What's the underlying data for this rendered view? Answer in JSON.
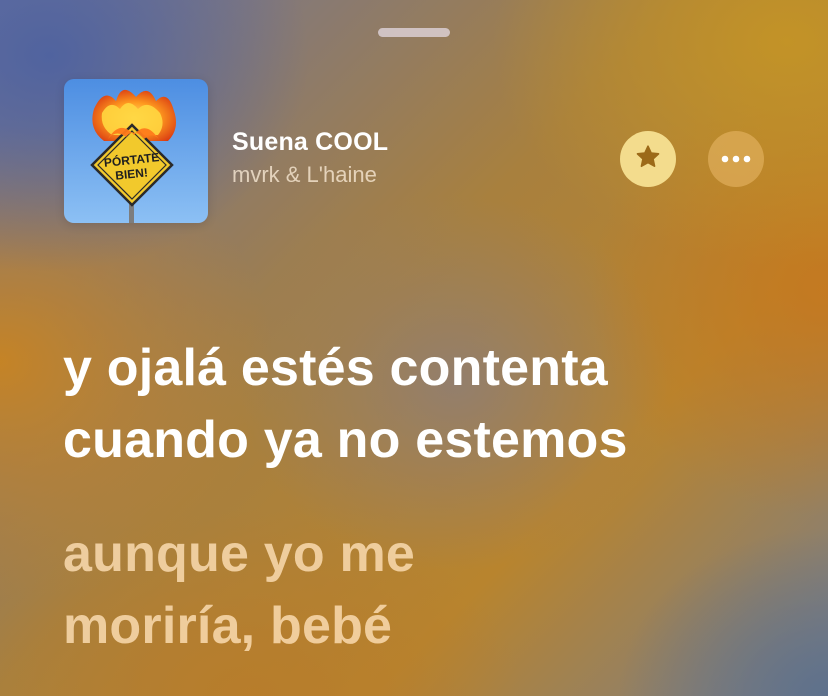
{
  "player": {
    "track_title": "Suena COOL",
    "artist": "mvrk & L'haine",
    "artwork": {
      "sign_line_1": "PÓRTATE",
      "sign_line_2": "BIEN!"
    },
    "favorite_icon": "star-icon",
    "more_icon": "ellipsis-icon"
  },
  "lyrics": [
    {
      "state": "active",
      "lines": [
        "y ojalá estés contenta",
        "cuando ya no estemos"
      ]
    },
    {
      "state": "upcoming",
      "lines": [
        "aunque yo me",
        "moriría, bebé"
      ]
    }
  ],
  "colors": {
    "favorite_button_bg": "#f3dc8d",
    "favorite_icon": "#9c6a18",
    "more_button_bg": "#e2ab5a",
    "active_lyric": "#ffffff",
    "upcoming_lyric": "#fcdeb4"
  }
}
